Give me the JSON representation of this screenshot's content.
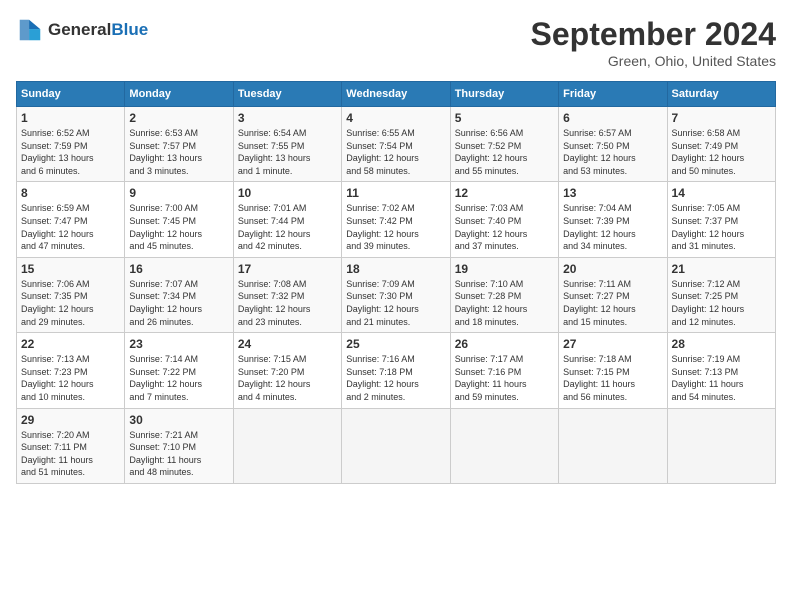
{
  "header": {
    "logo_general": "General",
    "logo_blue": "Blue",
    "month_title": "September 2024",
    "location": "Green, Ohio, United States"
  },
  "days_of_week": [
    "Sunday",
    "Monday",
    "Tuesday",
    "Wednesday",
    "Thursday",
    "Friday",
    "Saturday"
  ],
  "weeks": [
    [
      {
        "day": "1",
        "info": "Sunrise: 6:52 AM\nSunset: 7:59 PM\nDaylight: 13 hours\nand 6 minutes."
      },
      {
        "day": "2",
        "info": "Sunrise: 6:53 AM\nSunset: 7:57 PM\nDaylight: 13 hours\nand 3 minutes."
      },
      {
        "day": "3",
        "info": "Sunrise: 6:54 AM\nSunset: 7:55 PM\nDaylight: 13 hours\nand 1 minute."
      },
      {
        "day": "4",
        "info": "Sunrise: 6:55 AM\nSunset: 7:54 PM\nDaylight: 12 hours\nand 58 minutes."
      },
      {
        "day": "5",
        "info": "Sunrise: 6:56 AM\nSunset: 7:52 PM\nDaylight: 12 hours\nand 55 minutes."
      },
      {
        "day": "6",
        "info": "Sunrise: 6:57 AM\nSunset: 7:50 PM\nDaylight: 12 hours\nand 53 minutes."
      },
      {
        "day": "7",
        "info": "Sunrise: 6:58 AM\nSunset: 7:49 PM\nDaylight: 12 hours\nand 50 minutes."
      }
    ],
    [
      {
        "day": "8",
        "info": "Sunrise: 6:59 AM\nSunset: 7:47 PM\nDaylight: 12 hours\nand 47 minutes."
      },
      {
        "day": "9",
        "info": "Sunrise: 7:00 AM\nSunset: 7:45 PM\nDaylight: 12 hours\nand 45 minutes."
      },
      {
        "day": "10",
        "info": "Sunrise: 7:01 AM\nSunset: 7:44 PM\nDaylight: 12 hours\nand 42 minutes."
      },
      {
        "day": "11",
        "info": "Sunrise: 7:02 AM\nSunset: 7:42 PM\nDaylight: 12 hours\nand 39 minutes."
      },
      {
        "day": "12",
        "info": "Sunrise: 7:03 AM\nSunset: 7:40 PM\nDaylight: 12 hours\nand 37 minutes."
      },
      {
        "day": "13",
        "info": "Sunrise: 7:04 AM\nSunset: 7:39 PM\nDaylight: 12 hours\nand 34 minutes."
      },
      {
        "day": "14",
        "info": "Sunrise: 7:05 AM\nSunset: 7:37 PM\nDaylight: 12 hours\nand 31 minutes."
      }
    ],
    [
      {
        "day": "15",
        "info": "Sunrise: 7:06 AM\nSunset: 7:35 PM\nDaylight: 12 hours\nand 29 minutes."
      },
      {
        "day": "16",
        "info": "Sunrise: 7:07 AM\nSunset: 7:34 PM\nDaylight: 12 hours\nand 26 minutes."
      },
      {
        "day": "17",
        "info": "Sunrise: 7:08 AM\nSunset: 7:32 PM\nDaylight: 12 hours\nand 23 minutes."
      },
      {
        "day": "18",
        "info": "Sunrise: 7:09 AM\nSunset: 7:30 PM\nDaylight: 12 hours\nand 21 minutes."
      },
      {
        "day": "19",
        "info": "Sunrise: 7:10 AM\nSunset: 7:28 PM\nDaylight: 12 hours\nand 18 minutes."
      },
      {
        "day": "20",
        "info": "Sunrise: 7:11 AM\nSunset: 7:27 PM\nDaylight: 12 hours\nand 15 minutes."
      },
      {
        "day": "21",
        "info": "Sunrise: 7:12 AM\nSunset: 7:25 PM\nDaylight: 12 hours\nand 12 minutes."
      }
    ],
    [
      {
        "day": "22",
        "info": "Sunrise: 7:13 AM\nSunset: 7:23 PM\nDaylight: 12 hours\nand 10 minutes."
      },
      {
        "day": "23",
        "info": "Sunrise: 7:14 AM\nSunset: 7:22 PM\nDaylight: 12 hours\nand 7 minutes."
      },
      {
        "day": "24",
        "info": "Sunrise: 7:15 AM\nSunset: 7:20 PM\nDaylight: 12 hours\nand 4 minutes."
      },
      {
        "day": "25",
        "info": "Sunrise: 7:16 AM\nSunset: 7:18 PM\nDaylight: 12 hours\nand 2 minutes."
      },
      {
        "day": "26",
        "info": "Sunrise: 7:17 AM\nSunset: 7:16 PM\nDaylight: 11 hours\nand 59 minutes."
      },
      {
        "day": "27",
        "info": "Sunrise: 7:18 AM\nSunset: 7:15 PM\nDaylight: 11 hours\nand 56 minutes."
      },
      {
        "day": "28",
        "info": "Sunrise: 7:19 AM\nSunset: 7:13 PM\nDaylight: 11 hours\nand 54 minutes."
      }
    ],
    [
      {
        "day": "29",
        "info": "Sunrise: 7:20 AM\nSunset: 7:11 PM\nDaylight: 11 hours\nand 51 minutes."
      },
      {
        "day": "30",
        "info": "Sunrise: 7:21 AM\nSunset: 7:10 PM\nDaylight: 11 hours\nand 48 minutes."
      },
      {
        "day": "",
        "info": ""
      },
      {
        "day": "",
        "info": ""
      },
      {
        "day": "",
        "info": ""
      },
      {
        "day": "",
        "info": ""
      },
      {
        "day": "",
        "info": ""
      }
    ]
  ]
}
